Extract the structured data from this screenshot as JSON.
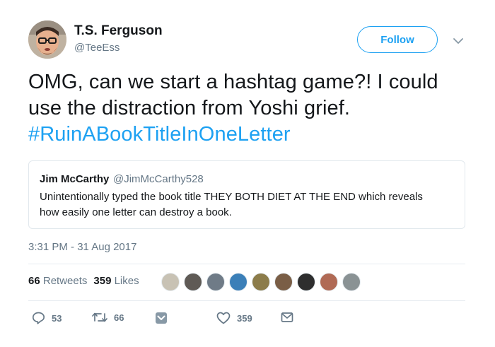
{
  "author": {
    "display_name": "T.S. Ferguson",
    "handle": "@TeeEss"
  },
  "follow_label": "Follow",
  "tweet": {
    "text_line1": "OMG, can we start a hashtag game?! I could",
    "text_line2": "use the distraction from Yoshi grief.",
    "hashtag": "#RuinABookTitleInOneLetter"
  },
  "quoted": {
    "display_name": "Jim McCarthy",
    "handle": "@JimMcCarthy528",
    "text_line1": "Unintentionally typed the book title THEY BOTH DIET AT THE END which reveals",
    "text_line2": "how easily one letter can destroy a book."
  },
  "timestamp": "3:31 PM - 31 Aug 2017",
  "stats": {
    "retweets_count": "66",
    "retweets_label": "Retweets",
    "likes_count": "359",
    "likes_label": "Likes"
  },
  "liker_avatar_colors": [
    "#c8c2b4",
    "#5f5a55",
    "#6f7b87",
    "#3b7fb8",
    "#8c7c4a",
    "#7a5e46",
    "#2e2e2e",
    "#b06a55",
    "#8a9294"
  ],
  "actions": {
    "reply_count": "53",
    "retweet_count": "66",
    "like_count": "359"
  },
  "colors": {
    "accent": "#1da1f2",
    "muted": "#657786",
    "text": "#14171a"
  }
}
